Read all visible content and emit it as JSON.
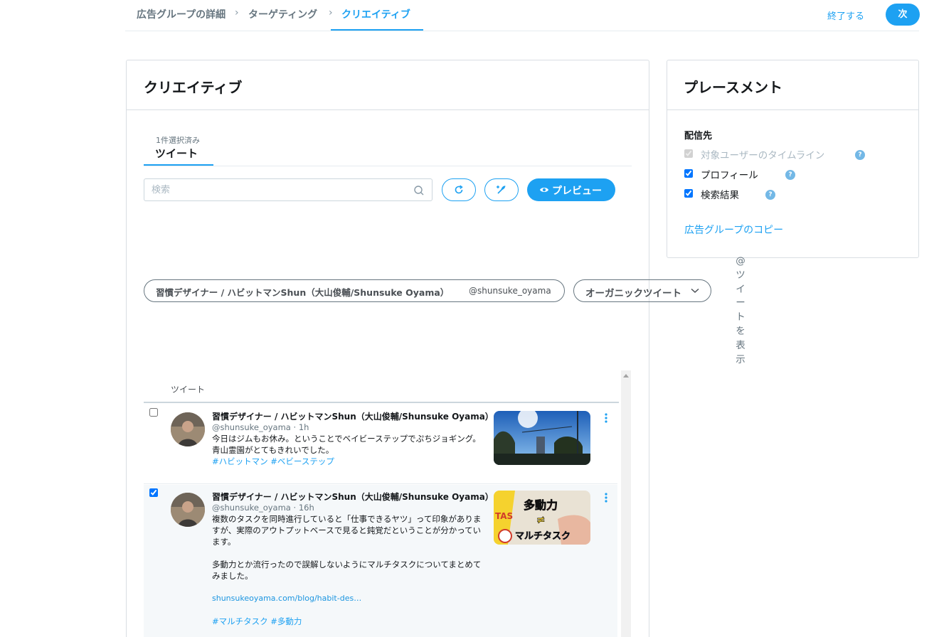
{
  "breadcrumb": {
    "step1": "広告グループの詳細",
    "step2": "ターゲティング",
    "step3": "クリエイティブ",
    "separator": "›"
  },
  "header_actions": {
    "end_label": "終了する",
    "next_label": "次"
  },
  "creative": {
    "title": "クリエイティブ",
    "tab_count": "1件選択済み",
    "tab_label": "ツイート",
    "search_placeholder": "検索",
    "preview_label": "プレビュー",
    "account_name": "習慣デザイナー / ハビットマンShun（大山俊輔/Shunsuke Oyama）",
    "account_handle": "@shunsuke_oyama",
    "tweet_type": "オーガニックツイート",
    "table_header": "ツイート"
  },
  "tweets": [
    {
      "checked": false,
      "name": "習慣デザイナー / ハビットマンShun（大山俊輔/Shunsuke Oyama）",
      "handle": "@shunsuke_oyama",
      "time": "1h",
      "text": "今日はジムもお休み。ということでベイビーステップでぷちジョギング。青山霊園がとてもきれいでした。",
      "tags": "#ハビットマン #ベビーステップ",
      "media": "tree-sky-photo"
    },
    {
      "checked": true,
      "name": "習慣デザイナー / ハビットマンShun（大山俊輔/Shunsuke Oyama）",
      "handle": "@shunsuke_oyama",
      "time": "16h",
      "text": "複数のタスクを同時進行していると「仕事できるヤツ」って印象がありますが、実際のアウトプットベースで見ると鈍覚だということが分かっています。",
      "text2": "多動力とか流行ったので誤解しないようにマルチタスクについてまとめてみました。",
      "link": "shunsukeoyama.com/blog/habit-des…",
      "tags": "#マルチタスク #多動力",
      "media": "multitask-thumbnail",
      "media_text_top": "多動力",
      "media_text_mid": "≠",
      "media_text_bottom": "マルチタスク",
      "media_text_corner": "TAS"
    }
  ],
  "placement": {
    "title": "プレースメント",
    "destination_label": "配信先",
    "options": [
      {
        "label": "対象ユーザーのタイムライン",
        "checked": true,
        "disabled": true
      },
      {
        "label": "プロフィール",
        "checked": true,
        "disabled": false
      },
      {
        "label": "検索結果",
        "checked": true,
        "disabled": false
      }
    ],
    "help_glyph": "?",
    "copy_label": "広告グループのコピー"
  },
  "vertical_text": [
    "@",
    "ツ",
    "イ",
    "ー",
    "ト",
    "を",
    "表",
    "示"
  ],
  "colors": {
    "accent": "#1da1f2",
    "muted": "#66757f",
    "row_selected": "#f5f8fa"
  }
}
